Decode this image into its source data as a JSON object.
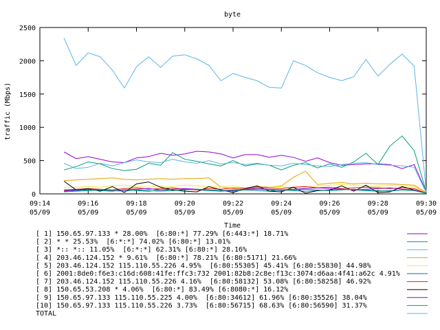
{
  "chart_data": {
    "type": "line",
    "title": "byte",
    "xlabel": "Time",
    "ylabel": "traffic (Mbps)",
    "ylim": [
      0,
      2500
    ],
    "yticks": [
      0,
      500,
      1000,
      1500,
      2000,
      2500
    ],
    "xlim": [
      0,
      16
    ],
    "xticks": [
      {
        "x": 0,
        "time": "09:14",
        "date": "05/09"
      },
      {
        "x": 2,
        "time": "09:16",
        "date": "05/09"
      },
      {
        "x": 4,
        "time": "09:18",
        "date": "05/09"
      },
      {
        "x": 6,
        "time": "09:20",
        "date": "05/09"
      },
      {
        "x": 8,
        "time": "09:22",
        "date": "05/09"
      },
      {
        "x": 10,
        "time": "09:24",
        "date": "05/09"
      },
      {
        "x": 12,
        "time": "09:26",
        "date": "05/09"
      },
      {
        "x": 14,
        "time": "09:28",
        "date": "05/09"
      },
      {
        "x": 16,
        "time": "09:30",
        "date": "05/09"
      }
    ],
    "x": [
      1.0,
      1.5,
      2.0,
      2.5,
      3.0,
      3.5,
      4.0,
      4.5,
      5.0,
      5.5,
      6.0,
      6.5,
      7.0,
      7.5,
      8.0,
      8.5,
      9.0,
      9.5,
      10.0,
      10.5,
      11.0,
      11.5,
      12.0,
      12.5,
      13.0,
      13.5,
      14.0,
      14.5,
      15.0,
      15.5,
      16.0
    ],
    "series": [
      {
        "name": "[ 1] 150.65.97.133 * 28.00%  [6:80:*] 77.29% [6:443:*] 18.71%",
        "color": "#9400d3",
        "values": [
          630,
          530,
          560,
          520,
          480,
          470,
          540,
          560,
          610,
          580,
          600,
          640,
          630,
          600,
          540,
          590,
          590,
          550,
          580,
          550,
          490,
          540,
          470,
          430,
          440,
          450,
          450,
          440,
          380,
          440,
          30
        ]
      },
      {
        "name": "[ 2] * * 25.53%  [6:*:*] 74.02% [6:80:*] 13.01%",
        "color": "#009e73",
        "values": [
          360,
          410,
          480,
          450,
          380,
          350,
          370,
          460,
          430,
          620,
          520,
          490,
          450,
          420,
          500,
          420,
          450,
          430,
          360,
          430,
          470,
          390,
          450,
          400,
          480,
          610,
          440,
          720,
          870,
          650,
          30
        ]
      },
      {
        "name": "[ 3] *:: *:: 11.05%  [6:*:*] 62.31% [6:80:*] 28.16%",
        "color": "#56b4e9",
        "values": [
          2340,
          1930,
          2120,
          2060,
          1860,
          1590,
          1910,
          2060,
          1900,
          2070,
          2090,
          2030,
          1930,
          1700,
          1810,
          1750,
          1700,
          1600,
          1590,
          2000,
          1930,
          1820,
          1750,
          1700,
          1760,
          2020,
          1770,
          1950,
          2100,
          1920,
          30
        ]
      },
      {
        "name": "[ 4] 203.46.124.152 * 9.61%  [6:80:*] 78.21% [6:80:5171] 21.66%",
        "color": "#e69f00",
        "values": [
          200,
          210,
          220,
          230,
          240,
          220,
          210,
          220,
          230,
          220,
          230,
          230,
          240,
          100,
          80,
          90,
          110,
          100,
          120,
          250,
          340,
          140,
          160,
          170,
          150,
          160,
          150,
          150,
          140,
          130,
          20
        ]
      },
      {
        "name": "[ 5] 203.46.124.152 115.110.55.226 4.95%  [6:80:55305] 45.41% [6:80:55830] 44.98%",
        "color": "#f0e442",
        "values": [
          90,
          100,
          110,
          100,
          120,
          130,
          110,
          100,
          120,
          110,
          130,
          120,
          110,
          100,
          120,
          90,
          80,
          100,
          110,
          90,
          100,
          120,
          130,
          140,
          130,
          120,
          110,
          130,
          120,
          110,
          10
        ]
      },
      {
        "name": "[ 6] 2001:8de0:f6e3:c16d:608:41fe:ffc3:732 2001:82b8:2c8e:f13c:3074:d6aa:4f41:a62c 4.91%",
        "color": "#0072b2",
        "values": [
          40,
          50,
          60,
          50,
          40,
          60,
          50,
          40,
          60,
          50,
          70,
          60,
          50,
          40,
          50,
          60,
          50,
          40,
          60,
          50,
          40,
          50,
          60,
          70,
          60,
          50,
          40,
          50,
          60,
          50,
          10
        ]
      },
      {
        "name": "[ 7] 203.46.124.152 115.110.55.226 4.16%  [6:80:58132] 53.08% [6:80:58258] 46.92%",
        "color": "#e51e10",
        "values": [
          60,
          70,
          80,
          70,
          60,
          80,
          90,
          70,
          80,
          90,
          70,
          60,
          80,
          70,
          90,
          80,
          100,
          90,
          80,
          100,
          110,
          90,
          100,
          80,
          90,
          100,
          90,
          80,
          90,
          80,
          10
        ]
      },
      {
        "name": "[ 8] 150.65.53.208 * 4.06%  [6:80:*] 83.49% [6:8080:*] 16.12%",
        "color": "#000000",
        "values": [
          190,
          60,
          80,
          40,
          110,
          20,
          150,
          180,
          100,
          60,
          40,
          30,
          110,
          60,
          20,
          80,
          120,
          40,
          30,
          100,
          10,
          50,
          60,
          120,
          40,
          130,
          20,
          30,
          110,
          60,
          10
        ]
      },
      {
        "name": "[ 9] 150.65.97.133 115.110.55.225 4.00%  [6:80:34612] 61.96% [6:80:35526] 38.04%",
        "color": "#9400d3",
        "values": [
          50,
          60,
          70,
          60,
          50,
          60,
          70,
          80,
          60,
          70,
          80,
          70,
          60,
          50,
          60,
          70,
          80,
          70,
          60,
          70,
          80,
          90,
          80,
          70,
          60,
          70,
          80,
          90,
          70,
          60,
          10
        ]
      },
      {
        "name": "[10] 150.65.97.133 115.110.55.226 3.73%  [6:80:56715] 68.63% [6:80:56590] 31.37%",
        "color": "#009e73",
        "values": [
          30,
          40,
          50,
          60,
          50,
          40,
          60,
          50,
          40,
          50,
          60,
          70,
          60,
          50,
          40,
          60,
          70,
          60,
          50,
          60,
          70,
          60,
          50,
          60,
          70,
          60,
          50,
          40,
          60,
          50,
          10
        ]
      },
      {
        "name": "TOTAL",
        "color": "#56b4e9",
        "values": [
          460,
          380,
          400,
          460,
          420,
          470,
          510,
          480,
          470,
          520,
          480,
          460,
          500,
          450,
          470,
          440,
          460,
          430,
          420,
          460,
          440,
          420,
          410,
          440,
          460,
          470,
          440,
          430,
          420,
          400,
          20
        ]
      }
    ],
    "grid": false,
    "legend": "bottom"
  }
}
